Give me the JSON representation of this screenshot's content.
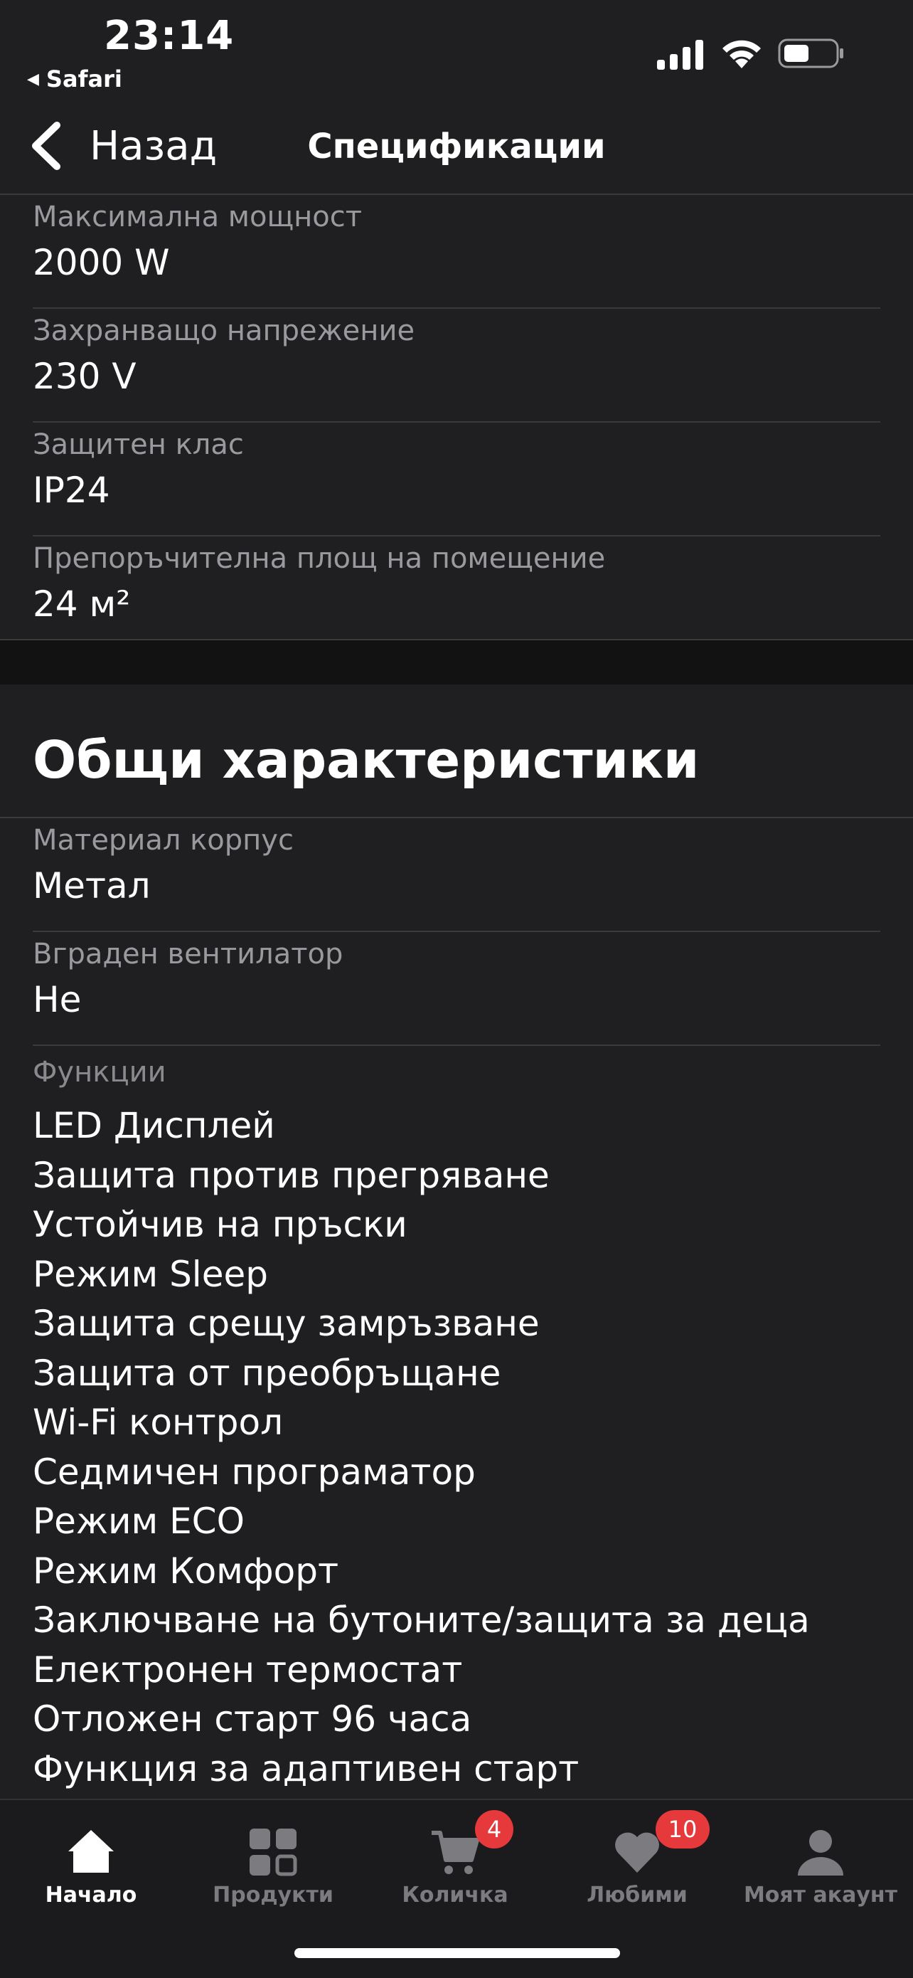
{
  "status_bar": {
    "time": "23:14",
    "back_app": "Safari",
    "back_icon": "triangle-left-icon",
    "icons": [
      "cellular-signal-icon",
      "wifi-icon",
      "battery-icon"
    ]
  },
  "nav": {
    "back_label": "Назад",
    "title": "Спецификации"
  },
  "specs_top": [
    {
      "label": "Максимална мощност",
      "value": "2000 W"
    },
    {
      "label": "Захранващо напрежение",
      "value": "230 V"
    },
    {
      "label": "Защитен клас",
      "value": "IP24"
    },
    {
      "label": "Препоръчителна площ на помещение",
      "value": "24 м²"
    }
  ],
  "general": {
    "title": "Общи характеристики",
    "rows": [
      {
        "label": "Материал корпус",
        "value": "Метал"
      },
      {
        "label": "Вграден вентилатор",
        "value": "Не"
      }
    ],
    "features_label": "Функции",
    "features": [
      "LED Дисплей",
      "Защита против прегряване",
      "Устойчив на пръски",
      "Режим Sleep",
      "Защита срещу замръзване",
      "Защита от преобръщане",
      "Wi-Fi контрол",
      "Седмичен програматор",
      "Режим ECO",
      "Режим Комфорт",
      "Заключване на бутоните/защита за деца",
      "Електронен термостат",
      "Отложен старт 96 часа",
      "Функция за адаптивен старт"
    ]
  },
  "tab_bar": {
    "tabs": [
      {
        "label": "Начало",
        "icon": "home-icon",
        "active": true
      },
      {
        "label": "Продукти",
        "icon": "grid-icon",
        "active": false
      },
      {
        "label": "Количка",
        "icon": "cart-icon",
        "active": false,
        "badge": "4"
      },
      {
        "label": "Любими",
        "icon": "heart-icon",
        "active": false,
        "badge": "10"
      },
      {
        "label": "Моят акаунт",
        "icon": "user-icon",
        "active": false
      }
    ]
  },
  "colors": {
    "background": "#1f1f21",
    "label_gray": "#9a9a9e",
    "badge_red": "#e5393c"
  }
}
